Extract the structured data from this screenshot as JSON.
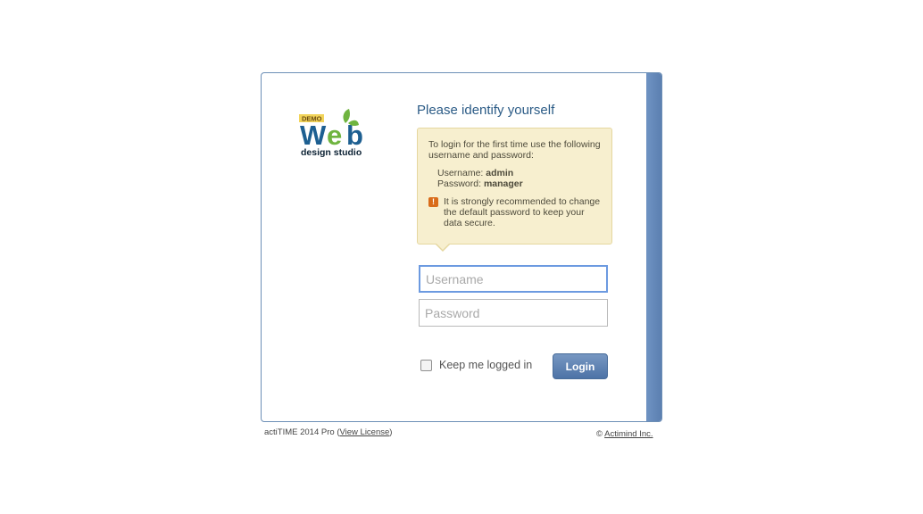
{
  "logo": {
    "demo_badge": "DEMO",
    "word": "Web",
    "subtitle": "design studio"
  },
  "title": "Please identify yourself",
  "info": {
    "intro": "To login for the first time use the following username and password:",
    "username_label": "Username:",
    "username_value": "admin",
    "password_label": "Password:",
    "password_value": "manager",
    "warning": "It is strongly recommended to change the default password to keep your data secure."
  },
  "form": {
    "username_placeholder": "Username",
    "password_placeholder": "Password",
    "keep_logged_in": "Keep me logged in",
    "login_button": "Login"
  },
  "footer": {
    "product": "actiTIME 2014 Pro",
    "view_license": "View License",
    "copyright_symbol": "©",
    "company": "Actimind Inc."
  },
  "colors": {
    "accent": "#5b7fb0",
    "info_bg": "#f7efcf",
    "title": "#2b5b86",
    "logo_blue": "#1d5f91",
    "logo_green": "#6fb43f"
  }
}
